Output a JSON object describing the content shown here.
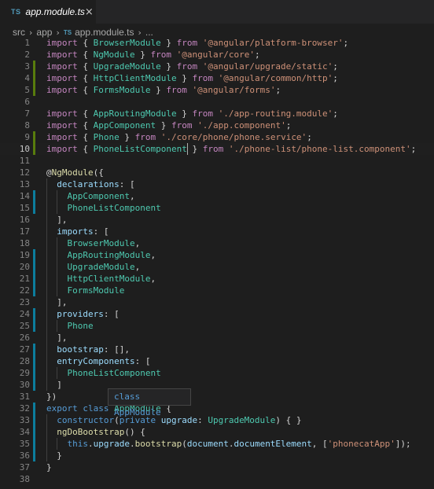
{
  "tab": {
    "lang_badge": "TS",
    "filename": "app.module.ts",
    "close_glyph": "×"
  },
  "breadcrumb": {
    "items": [
      "src",
      "app",
      "app.module.ts",
      "..."
    ],
    "lang_badge": "TS"
  },
  "colors": {
    "keyword": "#c586c0",
    "storage": "#569cd6",
    "type": "#4ec9b0",
    "variable": "#9cdcfe",
    "string": "#ce9178",
    "function": "#dcdcaa",
    "git_added": "#587c0c",
    "git_modified": "#0c7d9d"
  },
  "hover": {
    "text": "class AppModule"
  },
  "lines": [
    {
      "n": "1",
      "tokens": [
        [
          "kw",
          "import"
        ],
        [
          "pn",
          " { "
        ],
        [
          "id",
          "BrowserModule"
        ],
        [
          "pn",
          " } "
        ],
        [
          "kw",
          "from"
        ],
        [
          "pn",
          " "
        ],
        [
          "str",
          "'@angular/platform-browser'"
        ],
        [
          "pn",
          ";"
        ]
      ]
    },
    {
      "n": "2",
      "tokens": [
        [
          "kw",
          "import"
        ],
        [
          "pn",
          " { "
        ],
        [
          "id",
          "NgModule"
        ],
        [
          "pn",
          " } "
        ],
        [
          "kw",
          "from"
        ],
        [
          "pn",
          " "
        ],
        [
          "str",
          "'@angular/core'"
        ],
        [
          "pn",
          ";"
        ]
      ]
    },
    {
      "n": "3",
      "git": "added",
      "tokens": [
        [
          "kw",
          "import"
        ],
        [
          "pn",
          " { "
        ],
        [
          "id",
          "UpgradeModule"
        ],
        [
          "pn",
          " } "
        ],
        [
          "kw",
          "from"
        ],
        [
          "pn",
          " "
        ],
        [
          "str",
          "'@angular/upgrade/static'"
        ],
        [
          "pn",
          ";"
        ]
      ]
    },
    {
      "n": "4",
      "git": "added",
      "tokens": [
        [
          "kw",
          "import"
        ],
        [
          "pn",
          " { "
        ],
        [
          "id",
          "HttpClientModule"
        ],
        [
          "pn",
          " } "
        ],
        [
          "kw",
          "from"
        ],
        [
          "pn",
          " "
        ],
        [
          "str",
          "'@angular/common/http'"
        ],
        [
          "pn",
          ";"
        ]
      ]
    },
    {
      "n": "5",
      "git": "added",
      "tokens": [
        [
          "kw",
          "import"
        ],
        [
          "pn",
          " { "
        ],
        [
          "id",
          "FormsModule"
        ],
        [
          "pn",
          " } "
        ],
        [
          "kw",
          "from"
        ],
        [
          "pn",
          " "
        ],
        [
          "str",
          "'@angular/forms'"
        ],
        [
          "pn",
          ";"
        ]
      ]
    },
    {
      "n": "6",
      "tokens": []
    },
    {
      "n": "7",
      "tokens": [
        [
          "kw",
          "import"
        ],
        [
          "pn",
          " { "
        ],
        [
          "id",
          "AppRoutingModule"
        ],
        [
          "pn",
          " } "
        ],
        [
          "kw",
          "from"
        ],
        [
          "pn",
          " "
        ],
        [
          "str",
          "'./app-routing.module'"
        ],
        [
          "pn",
          ";"
        ]
      ]
    },
    {
      "n": "8",
      "tokens": [
        [
          "kw",
          "import"
        ],
        [
          "pn",
          " { "
        ],
        [
          "id",
          "AppComponent"
        ],
        [
          "pn",
          " } "
        ],
        [
          "kw",
          "from"
        ],
        [
          "pn",
          " "
        ],
        [
          "str",
          "'./app.component'"
        ],
        [
          "pn",
          ";"
        ]
      ]
    },
    {
      "n": "9",
      "git": "added",
      "tokens": [
        [
          "kw",
          "import"
        ],
        [
          "pn",
          " { "
        ],
        [
          "id",
          "Phone"
        ],
        [
          "pn",
          " } "
        ],
        [
          "kw",
          "from"
        ],
        [
          "pn",
          " "
        ],
        [
          "str",
          "'./core/phone/phone.service'"
        ],
        [
          "pn",
          ";"
        ]
      ]
    },
    {
      "n": "10",
      "git": "added",
      "active": true,
      "tokens": [
        [
          "kw",
          "import"
        ],
        [
          "pn",
          " { "
        ],
        [
          "id",
          "PhoneListComponent"
        ],
        [
          "pn",
          " } "
        ],
        [
          "kw",
          "from"
        ],
        [
          "pn",
          " "
        ],
        [
          "str",
          "'./phone-list/phone-list.component'"
        ],
        [
          "pn",
          ";"
        ]
      ]
    },
    {
      "n": "11",
      "tokens": []
    },
    {
      "n": "12",
      "tokens": [
        [
          "pn",
          "@"
        ],
        [
          "fn",
          "NgModule"
        ],
        [
          "pn",
          "({"
        ]
      ]
    },
    {
      "n": "13",
      "tokens": [
        [
          "pn",
          "  "
        ],
        [
          "var",
          "declarations"
        ],
        [
          "pn",
          ": ["
        ]
      ]
    },
    {
      "n": "14",
      "git": "modified",
      "tokens": [
        [
          "pn",
          "    "
        ],
        [
          "id",
          "AppComponent"
        ],
        [
          "pn",
          ","
        ]
      ]
    },
    {
      "n": "15",
      "git": "modified",
      "tokens": [
        [
          "pn",
          "    "
        ],
        [
          "id",
          "PhoneListComponent"
        ]
      ]
    },
    {
      "n": "16",
      "tokens": [
        [
          "pn",
          "  ],"
        ]
      ]
    },
    {
      "n": "17",
      "tokens": [
        [
          "pn",
          "  "
        ],
        [
          "var",
          "imports"
        ],
        [
          "pn",
          ": ["
        ]
      ]
    },
    {
      "n": "18",
      "tokens": [
        [
          "pn",
          "    "
        ],
        [
          "id",
          "BrowserModule"
        ],
        [
          "pn",
          ","
        ]
      ]
    },
    {
      "n": "19",
      "git": "modified",
      "tokens": [
        [
          "pn",
          "    "
        ],
        [
          "id",
          "AppRoutingModule"
        ],
        [
          "pn",
          ","
        ]
      ]
    },
    {
      "n": "20",
      "git": "modified",
      "tokens": [
        [
          "pn",
          "    "
        ],
        [
          "id",
          "UpgradeModule"
        ],
        [
          "pn",
          ","
        ]
      ]
    },
    {
      "n": "21",
      "git": "modified",
      "tokens": [
        [
          "pn",
          "    "
        ],
        [
          "id",
          "HttpClientModule"
        ],
        [
          "pn",
          ","
        ]
      ]
    },
    {
      "n": "22",
      "git": "modified",
      "tokens": [
        [
          "pn",
          "    "
        ],
        [
          "id",
          "FormsModule"
        ]
      ]
    },
    {
      "n": "23",
      "tokens": [
        [
          "pn",
          "  ],"
        ]
      ]
    },
    {
      "n": "24",
      "git": "modified",
      "tokens": [
        [
          "pn",
          "  "
        ],
        [
          "var",
          "providers"
        ],
        [
          "pn",
          ": ["
        ]
      ]
    },
    {
      "n": "25",
      "git": "modified",
      "tokens": [
        [
          "pn",
          "    "
        ],
        [
          "id",
          "Phone"
        ]
      ]
    },
    {
      "n": "26",
      "tokens": [
        [
          "pn",
          "  ],"
        ]
      ]
    },
    {
      "n": "27",
      "git": "modified",
      "tokens": [
        [
          "pn",
          "  "
        ],
        [
          "var",
          "bootstrap"
        ],
        [
          "pn",
          ": [],"
        ]
      ]
    },
    {
      "n": "28",
      "git": "modified",
      "tokens": [
        [
          "pn",
          "  "
        ],
        [
          "var",
          "entryComponents"
        ],
        [
          "pn",
          ": ["
        ]
      ]
    },
    {
      "n": "29",
      "git": "modified",
      "tokens": [
        [
          "pn",
          "    "
        ],
        [
          "id",
          "PhoneListComponent"
        ]
      ]
    },
    {
      "n": "30",
      "git": "modified",
      "tokens": [
        [
          "pn",
          "  ]"
        ]
      ]
    },
    {
      "n": "31",
      "tokens": [
        [
          "pn",
          "})"
        ]
      ]
    },
    {
      "n": "32",
      "git": "modified",
      "tokens": [
        [
          "kb",
          "export"
        ],
        [
          "pn",
          " "
        ],
        [
          "kb",
          "class"
        ],
        [
          "pn",
          " "
        ],
        [
          "id",
          "AppModule"
        ],
        [
          "pn",
          " {"
        ]
      ]
    },
    {
      "n": "33",
      "git": "modified",
      "tokens": [
        [
          "pn",
          "  "
        ],
        [
          "kb",
          "constructor"
        ],
        [
          "pn",
          "("
        ],
        [
          "kb",
          "private"
        ],
        [
          "pn",
          " "
        ],
        [
          "var",
          "upgrade"
        ],
        [
          "pn",
          ": "
        ],
        [
          "id",
          "UpgradeModule"
        ],
        [
          "pn",
          ") { }"
        ]
      ]
    },
    {
      "n": "34",
      "git": "modified",
      "tokens": [
        [
          "pn",
          "  "
        ],
        [
          "fn",
          "ngDoBootstrap"
        ],
        [
          "pn",
          "() {"
        ]
      ]
    },
    {
      "n": "35",
      "git": "modified",
      "tokens": [
        [
          "pn",
          "    "
        ],
        [
          "kb",
          "this"
        ],
        [
          "pn",
          "."
        ],
        [
          "var",
          "upgrade"
        ],
        [
          "pn",
          "."
        ],
        [
          "fn",
          "bootstrap"
        ],
        [
          "pn",
          "("
        ],
        [
          "var",
          "document"
        ],
        [
          "pn",
          "."
        ],
        [
          "var",
          "documentElement"
        ],
        [
          "pn",
          ", ["
        ],
        [
          "str",
          "'phonecatApp'"
        ],
        [
          "pn",
          "]);"
        ]
      ]
    },
    {
      "n": "36",
      "git": "modified",
      "tokens": [
        [
          "pn",
          "  }"
        ]
      ]
    },
    {
      "n": "37",
      "tokens": [
        [
          "pn",
          "}"
        ]
      ]
    },
    {
      "n": "38",
      "tokens": []
    }
  ]
}
